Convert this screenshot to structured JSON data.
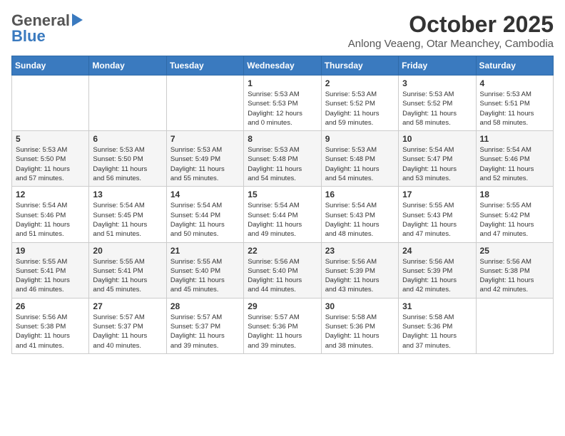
{
  "header": {
    "logo_line1": "General",
    "logo_line2": "Blue",
    "month_title": "October 2025",
    "subtitle": "Anlong Veaeng, Otar Meanchey, Cambodia"
  },
  "weekdays": [
    "Sunday",
    "Monday",
    "Tuesday",
    "Wednesday",
    "Thursday",
    "Friday",
    "Saturday"
  ],
  "weeks": [
    [
      {
        "day": "",
        "text": ""
      },
      {
        "day": "",
        "text": ""
      },
      {
        "day": "",
        "text": ""
      },
      {
        "day": "1",
        "text": "Sunrise: 5:53 AM\nSunset: 5:53 PM\nDaylight: 12 hours\nand 0 minutes."
      },
      {
        "day": "2",
        "text": "Sunrise: 5:53 AM\nSunset: 5:52 PM\nDaylight: 11 hours\nand 59 minutes."
      },
      {
        "day": "3",
        "text": "Sunrise: 5:53 AM\nSunset: 5:52 PM\nDaylight: 11 hours\nand 58 minutes."
      },
      {
        "day": "4",
        "text": "Sunrise: 5:53 AM\nSunset: 5:51 PM\nDaylight: 11 hours\nand 58 minutes."
      }
    ],
    [
      {
        "day": "5",
        "text": "Sunrise: 5:53 AM\nSunset: 5:50 PM\nDaylight: 11 hours\nand 57 minutes."
      },
      {
        "day": "6",
        "text": "Sunrise: 5:53 AM\nSunset: 5:50 PM\nDaylight: 11 hours\nand 56 minutes."
      },
      {
        "day": "7",
        "text": "Sunrise: 5:53 AM\nSunset: 5:49 PM\nDaylight: 11 hours\nand 55 minutes."
      },
      {
        "day": "8",
        "text": "Sunrise: 5:53 AM\nSunset: 5:48 PM\nDaylight: 11 hours\nand 54 minutes."
      },
      {
        "day": "9",
        "text": "Sunrise: 5:53 AM\nSunset: 5:48 PM\nDaylight: 11 hours\nand 54 minutes."
      },
      {
        "day": "10",
        "text": "Sunrise: 5:54 AM\nSunset: 5:47 PM\nDaylight: 11 hours\nand 53 minutes."
      },
      {
        "day": "11",
        "text": "Sunrise: 5:54 AM\nSunset: 5:46 PM\nDaylight: 11 hours\nand 52 minutes."
      }
    ],
    [
      {
        "day": "12",
        "text": "Sunrise: 5:54 AM\nSunset: 5:46 PM\nDaylight: 11 hours\nand 51 minutes."
      },
      {
        "day": "13",
        "text": "Sunrise: 5:54 AM\nSunset: 5:45 PM\nDaylight: 11 hours\nand 51 minutes."
      },
      {
        "day": "14",
        "text": "Sunrise: 5:54 AM\nSunset: 5:44 PM\nDaylight: 11 hours\nand 50 minutes."
      },
      {
        "day": "15",
        "text": "Sunrise: 5:54 AM\nSunset: 5:44 PM\nDaylight: 11 hours\nand 49 minutes."
      },
      {
        "day": "16",
        "text": "Sunrise: 5:54 AM\nSunset: 5:43 PM\nDaylight: 11 hours\nand 48 minutes."
      },
      {
        "day": "17",
        "text": "Sunrise: 5:55 AM\nSunset: 5:43 PM\nDaylight: 11 hours\nand 47 minutes."
      },
      {
        "day": "18",
        "text": "Sunrise: 5:55 AM\nSunset: 5:42 PM\nDaylight: 11 hours\nand 47 minutes."
      }
    ],
    [
      {
        "day": "19",
        "text": "Sunrise: 5:55 AM\nSunset: 5:41 PM\nDaylight: 11 hours\nand 46 minutes."
      },
      {
        "day": "20",
        "text": "Sunrise: 5:55 AM\nSunset: 5:41 PM\nDaylight: 11 hours\nand 45 minutes."
      },
      {
        "day": "21",
        "text": "Sunrise: 5:55 AM\nSunset: 5:40 PM\nDaylight: 11 hours\nand 45 minutes."
      },
      {
        "day": "22",
        "text": "Sunrise: 5:56 AM\nSunset: 5:40 PM\nDaylight: 11 hours\nand 44 minutes."
      },
      {
        "day": "23",
        "text": "Sunrise: 5:56 AM\nSunset: 5:39 PM\nDaylight: 11 hours\nand 43 minutes."
      },
      {
        "day": "24",
        "text": "Sunrise: 5:56 AM\nSunset: 5:39 PM\nDaylight: 11 hours\nand 42 minutes."
      },
      {
        "day": "25",
        "text": "Sunrise: 5:56 AM\nSunset: 5:38 PM\nDaylight: 11 hours\nand 42 minutes."
      }
    ],
    [
      {
        "day": "26",
        "text": "Sunrise: 5:56 AM\nSunset: 5:38 PM\nDaylight: 11 hours\nand 41 minutes."
      },
      {
        "day": "27",
        "text": "Sunrise: 5:57 AM\nSunset: 5:37 PM\nDaylight: 11 hours\nand 40 minutes."
      },
      {
        "day": "28",
        "text": "Sunrise: 5:57 AM\nSunset: 5:37 PM\nDaylight: 11 hours\nand 39 minutes."
      },
      {
        "day": "29",
        "text": "Sunrise: 5:57 AM\nSunset: 5:36 PM\nDaylight: 11 hours\nand 39 minutes."
      },
      {
        "day": "30",
        "text": "Sunrise: 5:58 AM\nSunset: 5:36 PM\nDaylight: 11 hours\nand 38 minutes."
      },
      {
        "day": "31",
        "text": "Sunrise: 5:58 AM\nSunset: 5:36 PM\nDaylight: 11 hours\nand 37 minutes."
      },
      {
        "day": "",
        "text": ""
      }
    ]
  ]
}
